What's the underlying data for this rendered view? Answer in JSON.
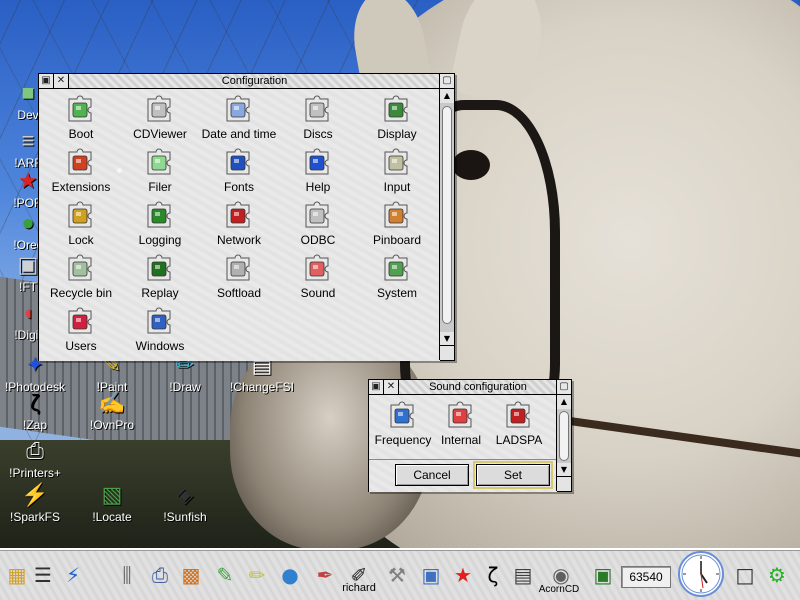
{
  "desktop": {
    "icons": [
      {
        "label": "Dev",
        "glyph": "■",
        "color": "#7fc77f"
      },
      {
        "label": "!ARF",
        "glyph": "≡",
        "color": "#cccccc"
      },
      {
        "label": "!POR",
        "glyph": "★",
        "color": "#e02020"
      },
      {
        "label": "!Orec",
        "glyph": "●",
        "color": "#3aa03a"
      },
      {
        "label": "!FT",
        "glyph": "▣",
        "color": "#d0d0d0"
      },
      {
        "label": "!Digit",
        "glyph": "◖",
        "color": "#e04040"
      },
      {
        "label": "!Photodesk",
        "glyph": "✦",
        "color": "#2050e0"
      },
      {
        "label": "!Paint",
        "glyph": "✎",
        "color": "#e0c040"
      },
      {
        "label": "!Draw",
        "glyph": "✏",
        "color": "#40c0e0"
      },
      {
        "label": "!ChangeFSI",
        "glyph": "▤",
        "color": "#ffffff"
      },
      {
        "label": "!Zap",
        "glyph": "ζ",
        "color": "#000000"
      },
      {
        "label": "!OvnPro",
        "glyph": "✍",
        "color": "#d0d0d0"
      },
      {
        "label": "!Printers+",
        "glyph": "⎙",
        "color": "#eeeeee"
      },
      {
        "label": "!SparkFS",
        "glyph": "⚡",
        "color": "#f0d020"
      },
      {
        "label": "!Locate",
        "glyph": "▧",
        "color": "#4aa04a"
      },
      {
        "label": "!Sunfish",
        "glyph": "◈",
        "color": "#333333"
      }
    ]
  },
  "config_window": {
    "title": "Configuration",
    "items": [
      {
        "label": "Boot",
        "icon": "boot-icon",
        "color": "#4fb34f"
      },
      {
        "label": "CDViewer",
        "icon": "cdviewer-icon",
        "color": "#c0c0c0"
      },
      {
        "label": "Date and time",
        "icon": "date-time-icon",
        "color": "#8aa8e0"
      },
      {
        "label": "Discs",
        "icon": "discs-icon",
        "color": "#c0c0c0"
      },
      {
        "label": "Display",
        "icon": "display-icon",
        "color": "#3a8a3a"
      },
      {
        "label": "Extensions",
        "icon": "extensions-icon",
        "color": "#d04020"
      },
      {
        "label": "Filer",
        "icon": "filer-icon",
        "color": "#8fd88f"
      },
      {
        "label": "Fonts",
        "icon": "fonts-icon",
        "color": "#2050c0"
      },
      {
        "label": "Help",
        "icon": "help-icon",
        "color": "#2050d0"
      },
      {
        "label": "Input",
        "icon": "input-icon",
        "color": "#c0c0a0"
      },
      {
        "label": "Lock",
        "icon": "lock-icon",
        "color": "#d0a020"
      },
      {
        "label": "Logging",
        "icon": "logging-icon",
        "color": "#2a8a2a"
      },
      {
        "label": "Network",
        "icon": "network-icon",
        "color": "#c02020"
      },
      {
        "label": "ODBC",
        "icon": "odbc-icon",
        "color": "#c0c0c0"
      },
      {
        "label": "Pinboard",
        "icon": "pinboard-icon",
        "color": "#d08030"
      },
      {
        "label": "Recycle bin",
        "icon": "recycle-bin-icon",
        "color": "#a0c0a0"
      },
      {
        "label": "Replay",
        "icon": "replay-icon",
        "color": "#207020"
      },
      {
        "label": "Softload",
        "icon": "softload-icon",
        "color": "#b0b0b0"
      },
      {
        "label": "Sound",
        "icon": "sound-icon",
        "color": "#e06060"
      },
      {
        "label": "System",
        "icon": "system-icon",
        "color": "#50a050"
      },
      {
        "label": "Users",
        "icon": "users-icon",
        "color": "#d02040"
      },
      {
        "label": "Windows",
        "icon": "windows-icon",
        "color": "#3060c0"
      }
    ]
  },
  "sound_window": {
    "title": "Sound configuration",
    "items": [
      {
        "label": "Frequency",
        "icon": "frequency-icon",
        "color": "#3070d0"
      },
      {
        "label": "Internal",
        "icon": "internal-speaker-icon",
        "color": "#e04040"
      },
      {
        "label": "LADSPA",
        "icon": "ladspa-icon",
        "color": "#c02020"
      }
    ],
    "cancel_label": "Cancel",
    "set_label": "Set"
  },
  "iconbar": {
    "items": [
      {
        "name": "harddisc-icon",
        "glyph": "▦",
        "color": "#d0a030"
      },
      {
        "name": "traffic-light-icon",
        "glyph": "☰",
        "color": "#303030"
      },
      {
        "name": "sparkfs-icon",
        "glyph": "⚡",
        "color": "#2060d0"
      },
      {
        "name": "mixer-icon",
        "glyph": "⫼",
        "color": "#707070"
      },
      {
        "name": "printer-icon",
        "glyph": "⎙",
        "color": "#4060a0"
      },
      {
        "name": "pinboard-icon",
        "glyph": "▩",
        "color": "#d07020"
      },
      {
        "name": "paint-icon",
        "glyph": "✎",
        "color": "#40a040"
      },
      {
        "name": "draw-icon",
        "glyph": "✏",
        "color": "#c0c040"
      },
      {
        "name": "globe-icon",
        "glyph": "●",
        "color": "#3080d0"
      },
      {
        "name": "artworks-icon",
        "glyph": "✒",
        "color": "#c04040"
      },
      {
        "name": "edit-icon",
        "glyph": "✐",
        "color": "#202020"
      },
      {
        "name": "tools-icon",
        "glyph": "⚒",
        "color": "#808080"
      },
      {
        "name": "blocks-icon",
        "glyph": "▣",
        "color": "#4070c0"
      },
      {
        "name": "star-icon",
        "glyph": "★",
        "color": "#e02020"
      },
      {
        "name": "zap-icon",
        "glyph": "ζ",
        "color": "#000000"
      },
      {
        "name": "printer-tray-icon",
        "glyph": "▤",
        "color": "#404040"
      },
      {
        "name": "cd-icon",
        "glyph": "◉",
        "color": "#606060"
      },
      {
        "name": "computer-icon",
        "glyph": "▣",
        "color": "#2a7a2a"
      },
      {
        "name": "window-manager-icon",
        "glyph": "□",
        "color": "#303030"
      },
      {
        "name": "task-manager-icon",
        "glyph": "⚙",
        "color": "#2ab02a"
      }
    ],
    "label_richard": "richard",
    "label_acorncd": "AcornCD",
    "free_space": "63540"
  }
}
